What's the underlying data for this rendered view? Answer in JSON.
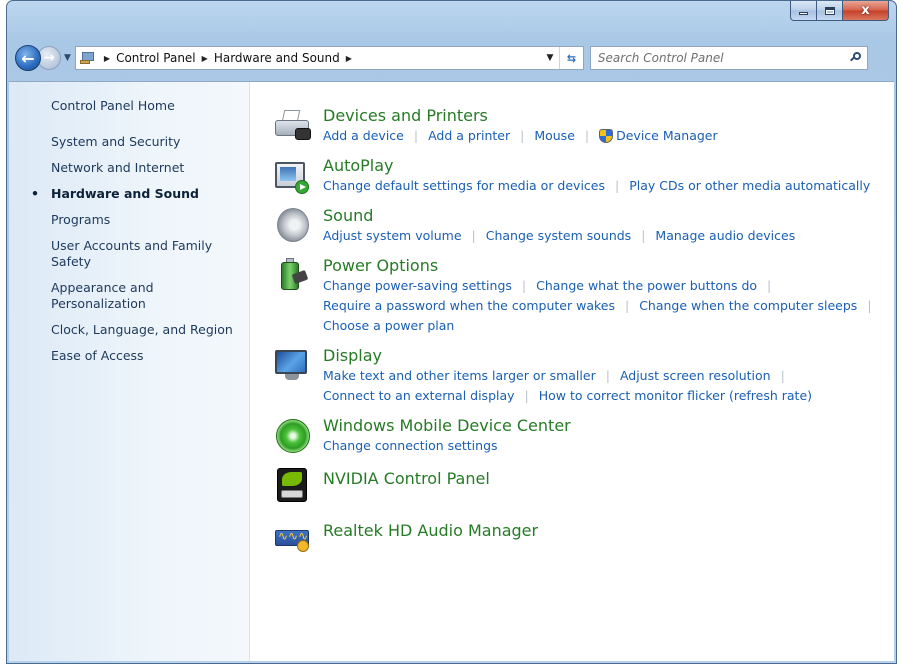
{
  "window": {
    "caption_buttons": {
      "minimize": "minimize",
      "maximize": "maximize",
      "close": "x"
    }
  },
  "navbar": {
    "breadcrumbs": [
      "Control Panel",
      "Hardware and Sound"
    ],
    "search_placeholder": "Search Control Panel"
  },
  "sidebar": {
    "home": "Control Panel Home",
    "items": [
      "System and Security",
      "Network and Internet",
      "Hardware and Sound",
      "Programs",
      "User Accounts and Family Safety",
      "Appearance and Personalization",
      "Clock, Language, and Region",
      "Ease of Access"
    ],
    "current_index": 2
  },
  "categories": [
    {
      "title": "Devices and Printers",
      "icon": "printer-icon",
      "lines": [
        [
          "Add a device",
          "Add a printer",
          "Mouse",
          "Device Manager"
        ]
      ]
    },
    {
      "title": "AutoPlay",
      "icon": "autoplay-icon",
      "lines": [
        [
          "Change default settings for media or devices",
          "Play CDs or other media automatically"
        ]
      ]
    },
    {
      "title": "Sound",
      "icon": "speaker-icon",
      "lines": [
        [
          "Adjust system volume",
          "Change system sounds",
          "Manage audio devices"
        ]
      ]
    },
    {
      "title": "Power Options",
      "icon": "battery-icon",
      "lines": [
        [
          "Change power-saving settings",
          "Change what the power buttons do"
        ],
        [
          "Require a password when the computer wakes",
          "Change when the computer sleeps"
        ],
        [
          "Choose a power plan"
        ]
      ]
    },
    {
      "title": "Display",
      "icon": "monitor-icon",
      "lines": [
        [
          "Make text and other items larger or smaller",
          "Adjust screen resolution"
        ],
        [
          "Connect to an external display",
          "How to correct monitor flicker (refresh rate)"
        ]
      ]
    },
    {
      "title": "Windows Mobile Device Center",
      "icon": "sync-disc-icon",
      "lines": [
        [
          "Change connection settings"
        ]
      ]
    },
    {
      "title": "NVIDIA Control Panel",
      "icon": "nvidia-icon",
      "lines": []
    },
    {
      "title": "Realtek HD Audio Manager",
      "icon": "realtek-audio-icon",
      "lines": []
    }
  ]
}
